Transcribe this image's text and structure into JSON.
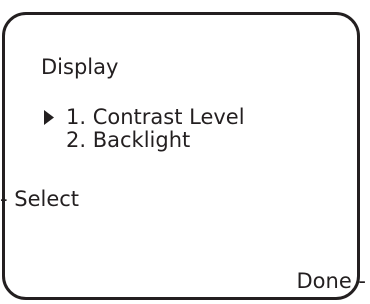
{
  "screen": {
    "title": "Display",
    "menu": {
      "selected_index": 0,
      "items": [
        {
          "label": "1. Contrast Level"
        },
        {
          "label": "2. Backlight"
        }
      ]
    },
    "softkeys": {
      "left": "- Select",
      "right": "Done -"
    }
  },
  "icons": {
    "cursor": "selection-arrow-icon"
  }
}
